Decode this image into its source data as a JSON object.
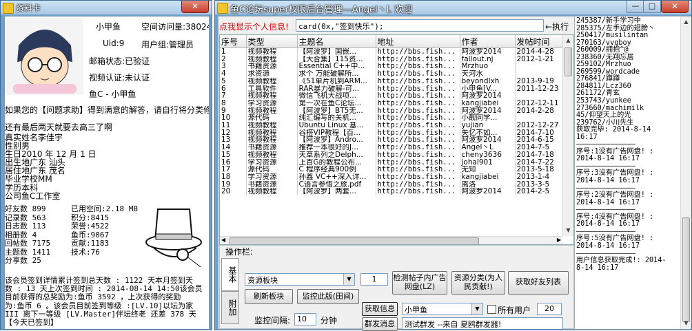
{
  "left_window": {
    "title": "资料卡",
    "username": "小甲鱼",
    "uid": "Uid:9",
    "visits": "空间访问量:38024",
    "usergroup": "用户组:管理员",
    "email_status": "邮箱状态:已验证",
    "video_status": "视频认证:未认证",
    "signature": "鱼C - 小甲鱼",
    "help_note": "如果您的【问题求助】得到满意的解答，请自行将分类修",
    "bio": "还有最后两天就要去高三了啊",
    "profile_lines": [
      "真实姓名李佳宇",
      "性别男",
      "生日2010 年 12 月 1 日",
      "出生地广东 汕头",
      "居住地广东 茂名",
      "毕业学校MM",
      "学历本科",
      "公司鱼C工作室"
    ],
    "stats_left": [
      "好友数 899",
      "记录数 563",
      "日志数 113",
      "相册数 4",
      "回帖数 7175",
      "主题数 1411",
      "分享数 25"
    ],
    "stats_right": [
      "已用空间:2.18 MB",
      "积分:8415",
      "荣誉:4522",
      "鱼币:9067",
      "贡献:1183",
      "技术:76"
    ],
    "signin_lines": [
      "该会员签到详情累计签到总天数 : 1122 天本月签到天",
      "数 : 13 天上次签到时间 : 2014-08-14 14:50该会员",
      "目前获得的总奖励为:鱼币 3592 ，上次获得的奖励",
      "为:鱼币 6 。该会员目前签到等级 :[LV.10]以坛为家",
      "III  离下一等级 [LV.Master]伴坛终老 还差 378 天",
      "【今天已签到】"
    ]
  },
  "main_window": {
    "title": "鱼C论坛super权限后台管理---Angel丶L 欢迎",
    "hide_info_link": "点我显示个人信息!",
    "command_value": "card(0x,\"签到快乐\");",
    "execute_button": "执行",
    "columns": [
      "序号",
      "类型",
      "主题名",
      "地址",
      "作者",
      "发帖时间"
    ],
    "rows": [
      [
        "1",
        "视频教程",
        "【阿波罗】国嵌...",
        "http://bbs.fish...",
        "阿波罗2014",
        "2014-4-28"
      ],
      [
        "2",
        "视频教程",
        "【大合集】115资...",
        "http://bbs.fish...",
        "fallout.nj",
        "2012-1-21"
      ],
      [
        "3",
        "书籍资源",
        "Essential C++中...",
        "http://bbs.fish...",
        "Mrzhuo",
        ""
      ],
      [
        "4",
        "求资源",
        "求个 万能破解所...",
        "http://bbs.fish...",
        "天河水",
        ""
      ],
      [
        "5",
        "视频教程",
        "《51单片机到ARM...",
        "http://bbs.fish...",
        "beyondlxh",
        "2013-9-19"
      ],
      [
        "6",
        "工具软件",
        "RAR暴力破解-可...",
        "http://bbs.fish...",
        "小甲鱼[V...",
        "2011-12-23"
      ],
      [
        "7",
        "视频教程",
        "微信飞机大战项...",
        "http://bbs.fish...",
        "阿波罗2014",
        ""
      ],
      [
        "8",
        "学习资源",
        "第一次在鱼C论坛...",
        "http://bbs.fish...",
        "kangjiabei",
        "2012-12-11"
      ],
      [
        "9",
        "视频教程",
        "【阿波罗】BT5无...",
        "http://bbs.fish...",
        "阿波罗2014",
        "2014-2-28"
      ],
      [
        "10",
        "源代码",
        "纯汇编写的关机...",
        "http://bbs.fish...",
        "小靓同学...",
        ""
      ],
      [
        "11",
        "视频教程",
        "Ubuntu Linux 基...",
        "http://bbs.fish...",
        "yujian",
        "2012-12-27"
      ],
      [
        "12",
        "视频教程",
        "谷搭VIP教程【百...",
        "http://bbs.fish...",
        "失忆不如...",
        "2014-7-10"
      ],
      [
        "13",
        "视频教程",
        "【阿波罗】Andro...",
        "http://bbs.fish...",
        "阿波罗2014",
        "2014-6-15"
      ],
      [
        "14",
        "书籍资源",
        "推荐一本很好的J...",
        "http://bbs.fish...",
        "Angel丶L",
        "2014-7-5"
      ],
      [
        "15",
        "视频教程",
        "天草系列之Delph...",
        "http://bbs.fish...",
        "cheny3636",
        "2014-7-18"
      ],
      [
        "16",
        "学习资源",
        "上百G的教程公布...",
        "http://bbs.fish...",
        "johal901",
        "2014-7-22"
      ],
      [
        "17",
        "源代码",
        "C 程序经典900例",
        "http://bbs.fish...",
        "无知",
        "2013-5-18"
      ],
      [
        "18",
        "学习资源",
        "孙鑫 VC++深入详...",
        "http://bbs.fish...",
        "kangjiabei",
        "2013-1-4"
      ],
      [
        "19",
        "书籍资源",
        "C语言参悟之旅.pdf",
        "http://bbs.fish...",
        "离洛",
        "2013-3-5"
      ],
      [
        "20",
        "视频教程",
        "【阿波罗】两套...",
        "http://bbs.fish...",
        "阿波罗2014",
        "2014-2-5"
      ]
    ],
    "ops_label": "操作栏:",
    "tab_basic": "基本",
    "tab_other": "附加",
    "category_select": "资源板块",
    "page_input": "1",
    "detect_ad_button": "检测帖子内广告网盘(LZ)",
    "classify_button": "资源分类(为人民贡献!)",
    "friends_button": "获取好友列表",
    "refresh_button": "刷新板块",
    "monitor_button": "监控此版(田间)",
    "get_info_button": "获取信息",
    "user_select": "小甲鱼",
    "all_users_label": "所有用户",
    "count_input": "20",
    "interval_label": "监控间隔:",
    "interval_value": "10",
    "interval_unit": "分钟",
    "mass_msg_button": "群发消息",
    "mass_msg_value": "测试群发 --来自 夏鸥群发器!"
  },
  "side_panel": {
    "lines": [
      "245387/新手学习中",
      "285375/左手边的翅膀丶",
      "250417/musilintan",
      "270163/vvqboy",
      "260009/拥抱^@",
      "238360/无翔忘居",
      "259102/Mrzhuo",
      "269599/wordcade",
      "276841/蹲蹲",
      "284811/Lcz360",
      "261172/青玄",
      "253743/yunkee",
      "273660/machimilk",
      "45/仰望天上的光",
      "239762/小川先生",
      "获取完毕: 2014-8-14",
      "16:17",
      "——————————————",
      "序号:1没有广告网盘! :",
      "2014-8-14 16:17",
      "——————————————",
      "序号:3没有广告网盘! :",
      "2014-8-14 16:17",
      "——————————————",
      "序号:2没有广告网盘! :",
      "2014-8-14 16:17",
      "——————————————",
      "序号:4没有广告网盘! :",
      "2014-8-14 16:17",
      "——————————————",
      "序号:5没有广告网盘! :",
      "2014-8-14 16:17",
      "——————————————",
      "用户信息获取完成!: 2014-",
      "8-14 16:17"
    ]
  }
}
